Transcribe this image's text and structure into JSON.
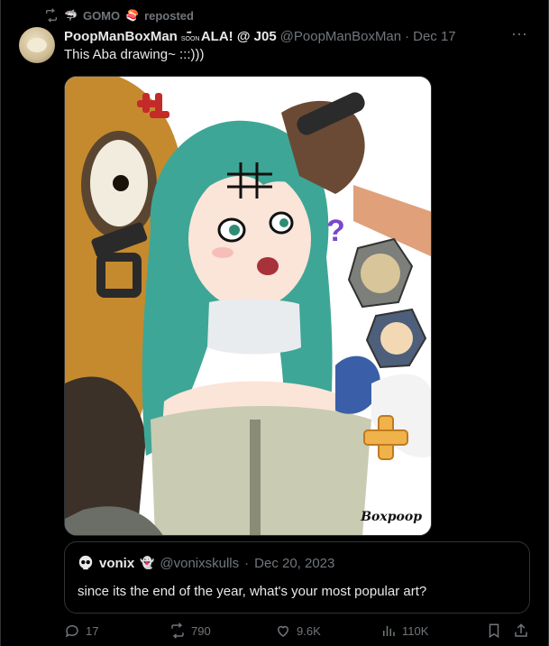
{
  "repost": {
    "label_user": "GOMO",
    "label_suffix": "reposted"
  },
  "tweet": {
    "author_name": "PoopManBoxMan",
    "author_name_suffix": "ALA! @ J05",
    "soon_badge": "SOON",
    "handle": "@PoopManBoxMan",
    "separator": "·",
    "date": "Dec 17",
    "text": "This Aba drawing~ :::)))",
    "more_label": "···"
  },
  "quote": {
    "name": "vonix",
    "handle": "@vonixskulls",
    "separator": "·",
    "date": "Dec 20, 2023",
    "text": "since its the end of the year, what's your most popular art?"
  },
  "artwork": {
    "signature": "Boxpoop"
  },
  "actions": {
    "replies": "17",
    "reposts": "790",
    "likes": "9.6K",
    "views": "110K"
  },
  "colors": {
    "background": "#000000",
    "text_primary": "#e7e9ea",
    "text_secondary": "#71767b",
    "border": "#2f3336"
  }
}
